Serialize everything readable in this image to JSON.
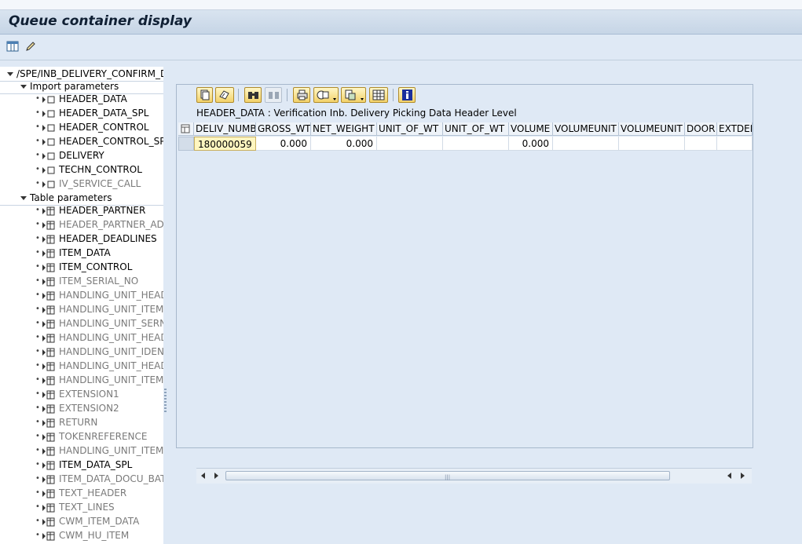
{
  "window": {
    "title": "Queue container display"
  },
  "toolbar": {
    "buttons": [
      {
        "icon": "layout-icon"
      },
      {
        "icon": "pencil-icon"
      }
    ]
  },
  "tree": {
    "root": "/SPE/INB_DELIVERY_CONFIRM_DE",
    "import_label": "Import parameters",
    "import_params": [
      {
        "label": "HEADER_DATA",
        "active": true
      },
      {
        "label": "HEADER_DATA_SPL",
        "active": true
      },
      {
        "label": "HEADER_CONTROL",
        "active": true
      },
      {
        "label": "HEADER_CONTROL_SPL",
        "active": true
      },
      {
        "label": "DELIVERY",
        "active": true
      },
      {
        "label": "TECHN_CONTROL",
        "active": true
      },
      {
        "label": "IV_SERVICE_CALL",
        "active": false
      }
    ],
    "table_label": "Table parameters",
    "table_params": [
      {
        "label": "HEADER_PARTNER",
        "active": true
      },
      {
        "label": "HEADER_PARTNER_ADD",
        "active": false
      },
      {
        "label": "HEADER_DEADLINES",
        "active": true
      },
      {
        "label": "ITEM_DATA",
        "active": true
      },
      {
        "label": "ITEM_CONTROL",
        "active": true
      },
      {
        "label": "ITEM_SERIAL_NO",
        "active": false
      },
      {
        "label": "HANDLING_UNIT_HEADE",
        "active": false
      },
      {
        "label": "HANDLING_UNIT_ITEM",
        "active": false
      },
      {
        "label": "HANDLING_UNIT_SERNO",
        "active": false
      },
      {
        "label": "HANDLING_UNIT_HEADE",
        "active": false
      },
      {
        "label": "HANDLING_UNIT_IDENT",
        "active": false
      },
      {
        "label": "HANDLING_UNIT_HEADE",
        "active": false
      },
      {
        "label": "HANDLING_UNIT_ITEMS",
        "active": false
      },
      {
        "label": "EXTENSION1",
        "active": false
      },
      {
        "label": "EXTENSION2",
        "active": false
      },
      {
        "label": "RETURN",
        "active": false
      },
      {
        "label": "TOKENREFERENCE",
        "active": false
      },
      {
        "label": "HANDLING_UNIT_ITEM_",
        "active": false
      },
      {
        "label": "ITEM_DATA_SPL",
        "active": true
      },
      {
        "label": "ITEM_DATA_DOCU_BAT",
        "active": false
      },
      {
        "label": "TEXT_HEADER",
        "active": false
      },
      {
        "label": "TEXT_LINES",
        "active": false
      },
      {
        "label": "CWM_ITEM_DATA",
        "active": false
      },
      {
        "label": "CWM_HU_ITEM",
        "active": false
      }
    ]
  },
  "alv": {
    "title": "HEADER_DATA : Verification Inb. Delivery Picking Data Header Level",
    "columns": [
      "DELIV_NUMB",
      "GROSS_WT",
      "NET_WEIGHT",
      "UNIT_OF_WT",
      "UNIT_OF_WT",
      "VOLUME",
      "VOLUMEUNIT",
      "VOLUMEUNIT",
      "DOOR",
      "EXTDEL"
    ],
    "rows": [
      [
        "180000059",
        "0.000",
        "0.000",
        "",
        "",
        "0.000",
        "",
        "",
        "",
        ""
      ]
    ],
    "toolbar_icons": [
      "details-icon",
      "filter-icon",
      "find-icon",
      "find-next-icon",
      "print-icon",
      "views-icon",
      "export-icon",
      "layout-grid-icon",
      "info-icon"
    ]
  }
}
